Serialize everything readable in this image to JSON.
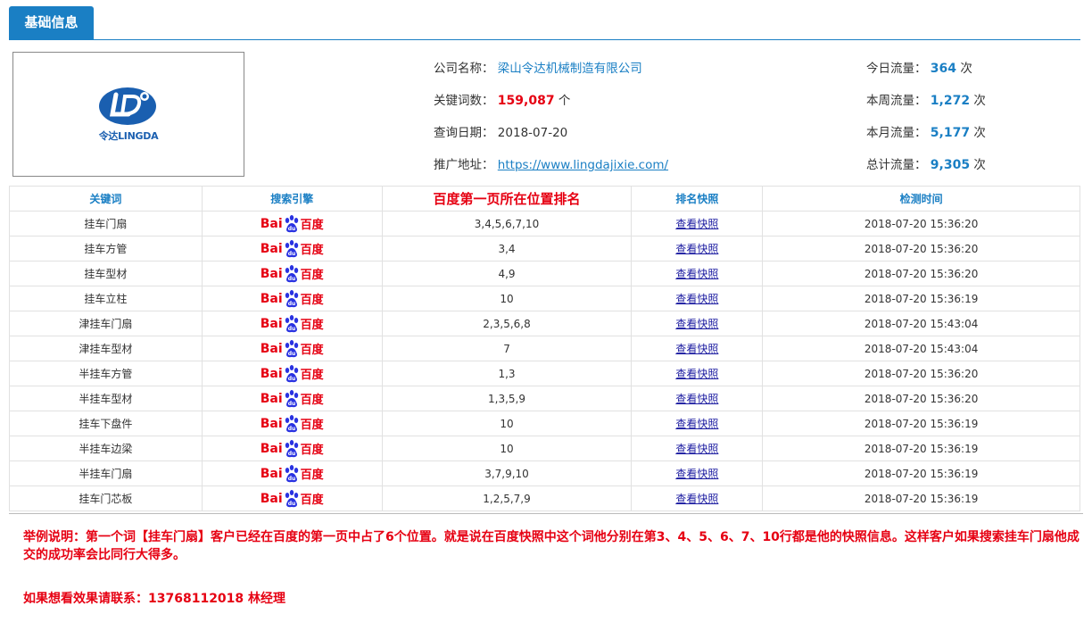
{
  "tab": {
    "label": "基础信息"
  },
  "logo": {
    "text": "令达LINGDA"
  },
  "info_left": [
    {
      "label": "公司名称：",
      "value": "梁山令达机械制造有限公司"
    },
    {
      "label": "关键词数：",
      "value": "159,087",
      "unit": "个"
    },
    {
      "label": "查询日期：",
      "value": "2018-07-20"
    },
    {
      "label": "推广地址：",
      "value": "https://www.lingdajixie.com/"
    }
  ],
  "info_right": [
    {
      "label": "今日流量：",
      "value": "364",
      "unit": "次"
    },
    {
      "label": "本周流量：",
      "value": "1,272",
      "unit": "次"
    },
    {
      "label": "本月流量：",
      "value": "5,177",
      "unit": "次"
    },
    {
      "label": "总计流量：",
      "value": "9,305",
      "unit": "次"
    }
  ],
  "table": {
    "headers": [
      "关键词",
      "搜索引擎",
      "百度第一页所在位置排名",
      "排名快照",
      "检测时间"
    ],
    "engine_text_a": "Bai",
    "engine_text_b": "百度",
    "snapshot_label": "查看快照",
    "rows": [
      {
        "keyword": "挂车门扇",
        "rank": "3,4,5,6,7,10",
        "time": "2018-07-20 15:36:20"
      },
      {
        "keyword": "挂车方管",
        "rank": "3,4",
        "time": "2018-07-20 15:36:20"
      },
      {
        "keyword": "挂车型材",
        "rank": "4,9",
        "time": "2018-07-20 15:36:20"
      },
      {
        "keyword": "挂车立柱",
        "rank": "10",
        "time": "2018-07-20 15:36:19"
      },
      {
        "keyword": "津挂车门扇",
        "rank": "2,3,5,6,8",
        "time": "2018-07-20 15:43:04"
      },
      {
        "keyword": "津挂车型材",
        "rank": "7",
        "time": "2018-07-20 15:43:04"
      },
      {
        "keyword": "半挂车方管",
        "rank": "1,3",
        "time": "2018-07-20 15:36:20"
      },
      {
        "keyword": "半挂车型材",
        "rank": "1,3,5,9",
        "time": "2018-07-20 15:36:20"
      },
      {
        "keyword": "挂车下盘件",
        "rank": "10",
        "time": "2018-07-20 15:36:19"
      },
      {
        "keyword": "半挂车边梁",
        "rank": "10",
        "time": "2018-07-20 15:36:19"
      },
      {
        "keyword": "半挂车门扇",
        "rank": "3,7,9,10",
        "time": "2018-07-20 15:36:19"
      },
      {
        "keyword": "挂车门芯板",
        "rank": "1,2,5,7,9",
        "time": "2018-07-20 15:36:19"
      }
    ]
  },
  "note": "举例说明：第一个词【挂车门扇】客户已经在百度的第一页中占了6个位置。就是说在百度快照中这个词他分别在第3、4、5、6、7、10行都是他的快照信息。这样客户如果搜索挂车门扇他成交的成功率会比同行大得多。",
  "contact": "如果想看效果请联系：13768112018  林经理",
  "colors": {
    "accent": "#1a7fc4",
    "red": "#e60012"
  }
}
